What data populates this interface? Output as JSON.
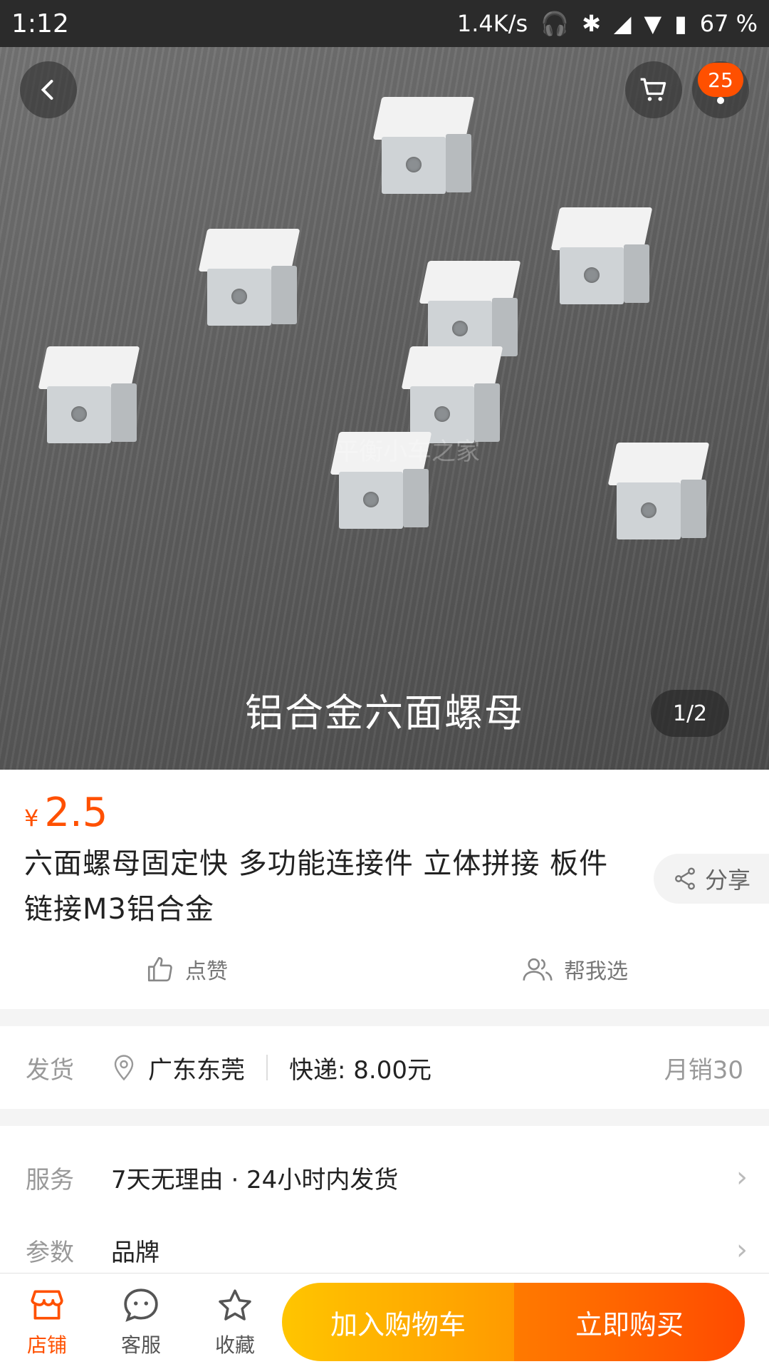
{
  "status_bar": {
    "time": "1:12",
    "net_speed": "1.4K/s",
    "battery": "67 %"
  },
  "header": {
    "cart_badge": "25"
  },
  "gallery": {
    "caption": "铝合金六面螺母",
    "watermark": "平衡小车之家",
    "indicator": "1/2"
  },
  "product": {
    "currency": "¥",
    "price": "2.5",
    "title": "六面螺母固定快  多功能连接件  立体拼接  板件链接M3铝合金",
    "share_label": "分享",
    "like_label": "点赞",
    "help_label": "帮我选"
  },
  "shipping": {
    "label": "发货",
    "location": "广东东莞",
    "express": "快递: 8.00元",
    "monthly_sales": "月销30"
  },
  "service": {
    "label": "服务",
    "value": "7天无理由 · 24小时内发货"
  },
  "params": {
    "label": "参数",
    "value": "品牌"
  },
  "bottom_nav": {
    "shop": "店铺",
    "service": "客服",
    "favorite": "收藏",
    "add_to_cart": "加入购物车",
    "buy_now": "立即购买"
  },
  "colors": {
    "accent": "#ff5000",
    "cart_button": "#ffb000",
    "buy_button": "#ff5a00"
  }
}
